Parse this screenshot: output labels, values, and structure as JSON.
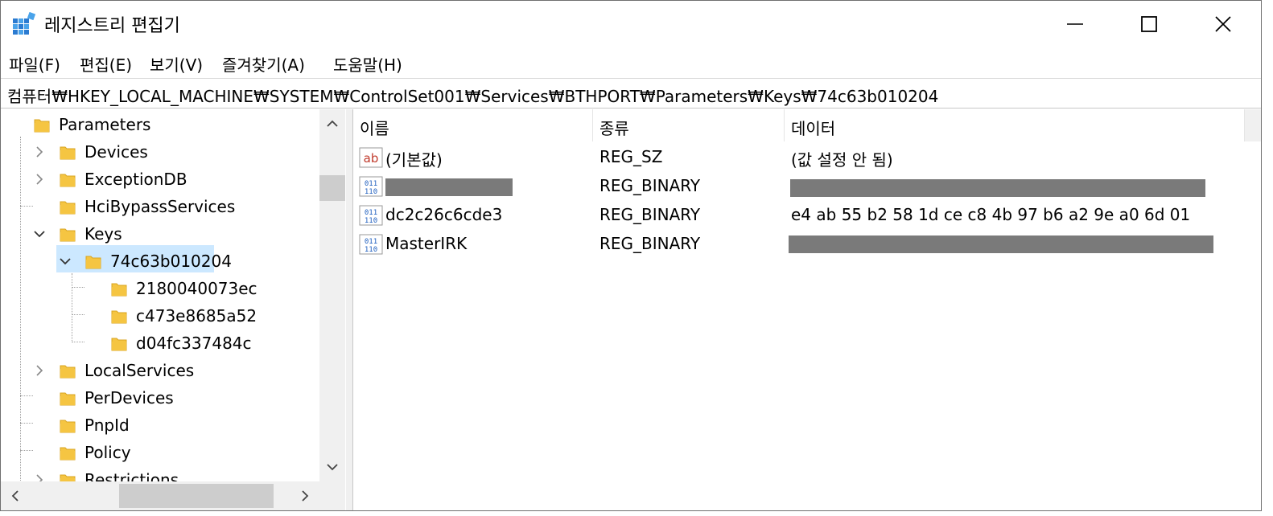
{
  "window": {
    "title": "레지스트리 편집기"
  },
  "menu": [
    {
      "label": "파일(F)"
    },
    {
      "label": "편집(E)"
    },
    {
      "label": "보기(V)"
    },
    {
      "label": "즐겨찾기(A)"
    },
    {
      "label": "도움말(H)"
    }
  ],
  "address": {
    "path": "컴퓨터₩HKEY_LOCAL_MACHINE₩SYSTEM₩ControlSet001₩Services₩BTHPORT₩Parameters₩Keys₩74c63b010204"
  },
  "tree": {
    "items": [
      {
        "label": "Parameters",
        "expander": "none",
        "level": 0
      },
      {
        "label": "Devices",
        "expander": "collapsed",
        "level": 1
      },
      {
        "label": "ExceptionDB",
        "expander": "collapsed",
        "level": 1
      },
      {
        "label": "HciBypassServices",
        "expander": "none",
        "level": 1
      },
      {
        "label": "Keys",
        "expander": "expanded",
        "level": 1
      },
      {
        "label": "74c63b010204",
        "expander": "expanded",
        "level": 2,
        "selected": true
      },
      {
        "label": "2180040073ec",
        "expander": "none",
        "level": 3
      },
      {
        "label": "c473e8685a52",
        "expander": "none",
        "level": 3
      },
      {
        "label": "d04fc337484c",
        "expander": "none",
        "level": 3
      },
      {
        "label": "LocalServices",
        "expander": "collapsed",
        "level": 1
      },
      {
        "label": "PerDevices",
        "expander": "none",
        "level": 1
      },
      {
        "label": "PnpId",
        "expander": "none",
        "level": 1
      },
      {
        "label": "Policy",
        "expander": "none",
        "level": 1
      },
      {
        "label": "Restrictions",
        "expander": "collapsed",
        "level": 1
      }
    ]
  },
  "list": {
    "columns": {
      "name": "이름",
      "type": "종류",
      "data": "데이터"
    },
    "rows": [
      {
        "name": "(기본값)",
        "type": "REG_SZ",
        "data": "(값 설정 안 됨)",
        "icon": "string-value-icon",
        "name_redacted": false,
        "data_redacted": false
      },
      {
        "name": "",
        "type": "REG_BINARY",
        "data": "",
        "icon": "binary-value-icon",
        "name_redacted": true,
        "data_redacted": true
      },
      {
        "name": "dc2c26c6cde3",
        "type": "REG_BINARY",
        "data": "e4 ab 55 b2 58 1d ce c8 4b 97 b6 a2 9e a0 6d 01",
        "icon": "binary-value-icon",
        "name_redacted": false,
        "data_redacted": false
      },
      {
        "name": "MasterIRK",
        "type": "REG_BINARY",
        "data": "",
        "icon": "binary-value-icon",
        "name_redacted": false,
        "data_redacted": true
      }
    ]
  },
  "colors": {
    "folder": "#f5c542",
    "selection": "#cce8ff",
    "redaction": "#7a7a7a",
    "string_icon_text": "#c0392b",
    "binary_icon_text": "#1f5fbf"
  }
}
